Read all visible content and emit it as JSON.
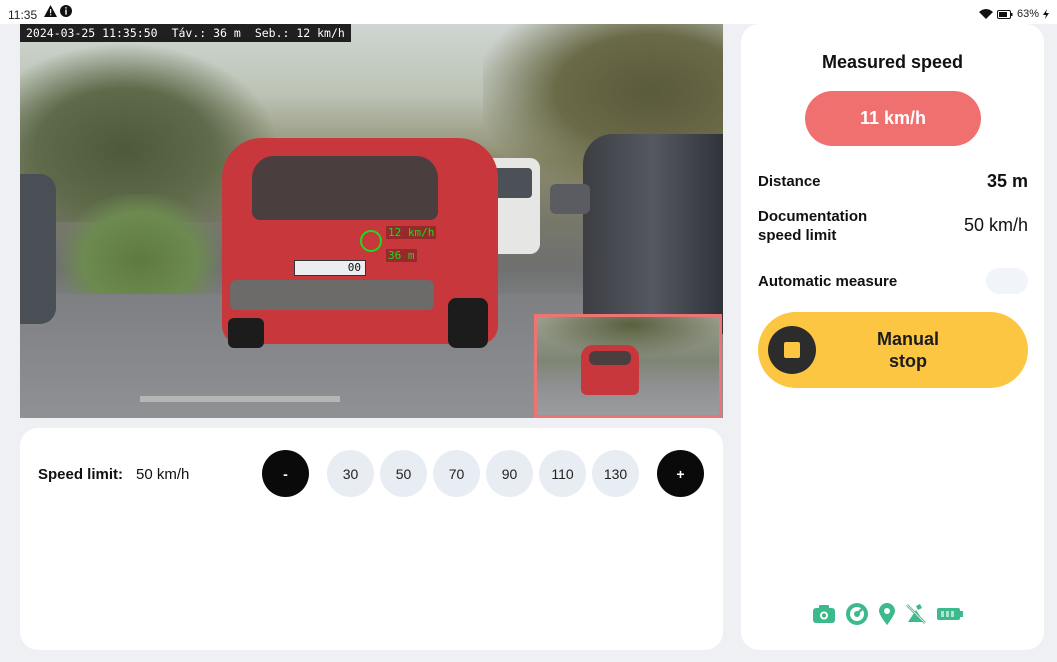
{
  "status_bar": {
    "time": "11:35",
    "battery": "63%"
  },
  "camera": {
    "overlay_timestamp": "2024-03-25 11:35:50",
    "overlay_distance": "Táv.: 36 m",
    "overlay_speed": "Seb.: 12 km/h",
    "plate_text": "00",
    "target_speed": "12 km/h",
    "target_distance": "36 m"
  },
  "speed_limit": {
    "label": "Speed limit:",
    "value": "50 km/h",
    "minus_label": "-",
    "plus_label": "+",
    "presets": [
      "30",
      "50",
      "70",
      "90",
      "110",
      "130"
    ]
  },
  "right_panel": {
    "title": "Measured speed",
    "measured_speed": "11 km/h",
    "distance_label": "Distance",
    "distance_value": "35 m",
    "doc_limit_label": "Documentation\nspeed limit",
    "doc_limit_value": "50 km/h",
    "auto_measure_label": "Automatic measure",
    "manual_stop_label": "Manual\nstop"
  },
  "colors": {
    "measured_pill": "#f07070",
    "manual_button": "#fcc642",
    "status_icon_green": "#3dba8b",
    "target_green": "#14e014"
  },
  "status_icons": [
    "camera-icon",
    "speedometer-icon",
    "location-pin-icon",
    "gps-off-icon",
    "battery-icon"
  ]
}
